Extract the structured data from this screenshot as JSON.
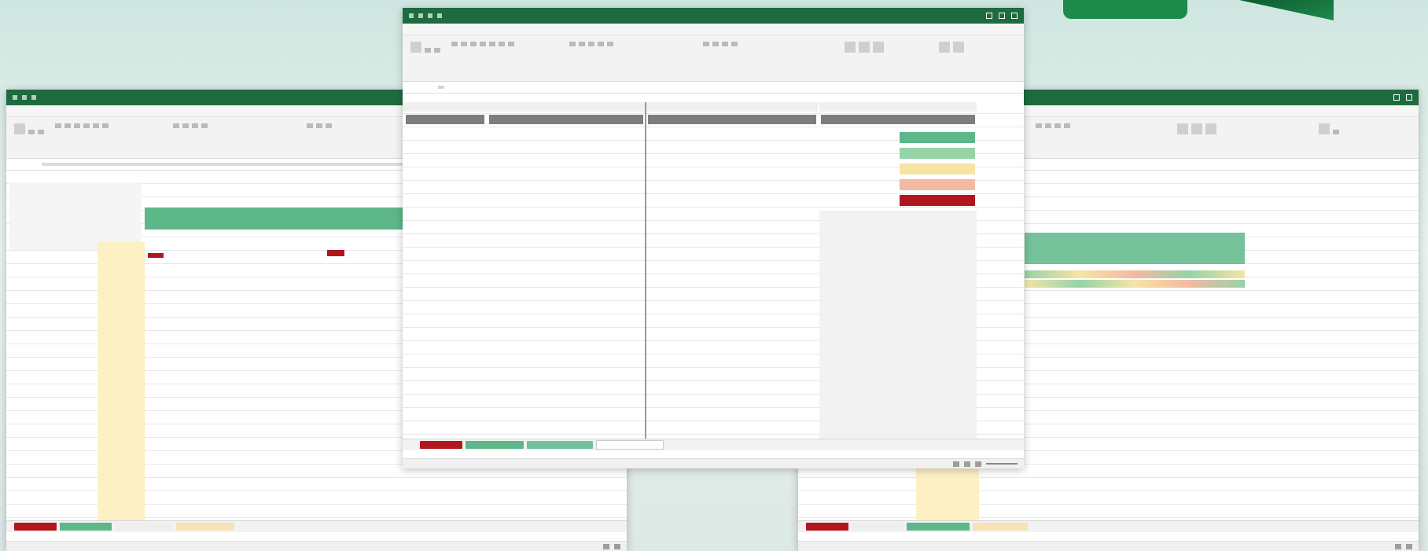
{
  "colors": {
    "excel_green": "#1e6b3f",
    "header_gray": "#7d7d7d",
    "scale": [
      "#5db789",
      "#96d3a7",
      "#f6e4a6",
      "#f4b9a3",
      "#b3151c"
    ],
    "tab_red": "#b3151c",
    "tab_green": "#5db789",
    "tab_peach": "#f8e3b6",
    "highlight_yellow": "#fdf0c4"
  },
  "icons": {
    "window_controls": [
      "minimize-icon",
      "maximize-icon",
      "close-icon"
    ],
    "quick_access": [
      "autosave-toggle-icon",
      "save-icon",
      "undo-icon",
      "redo-icon"
    ]
  }
}
